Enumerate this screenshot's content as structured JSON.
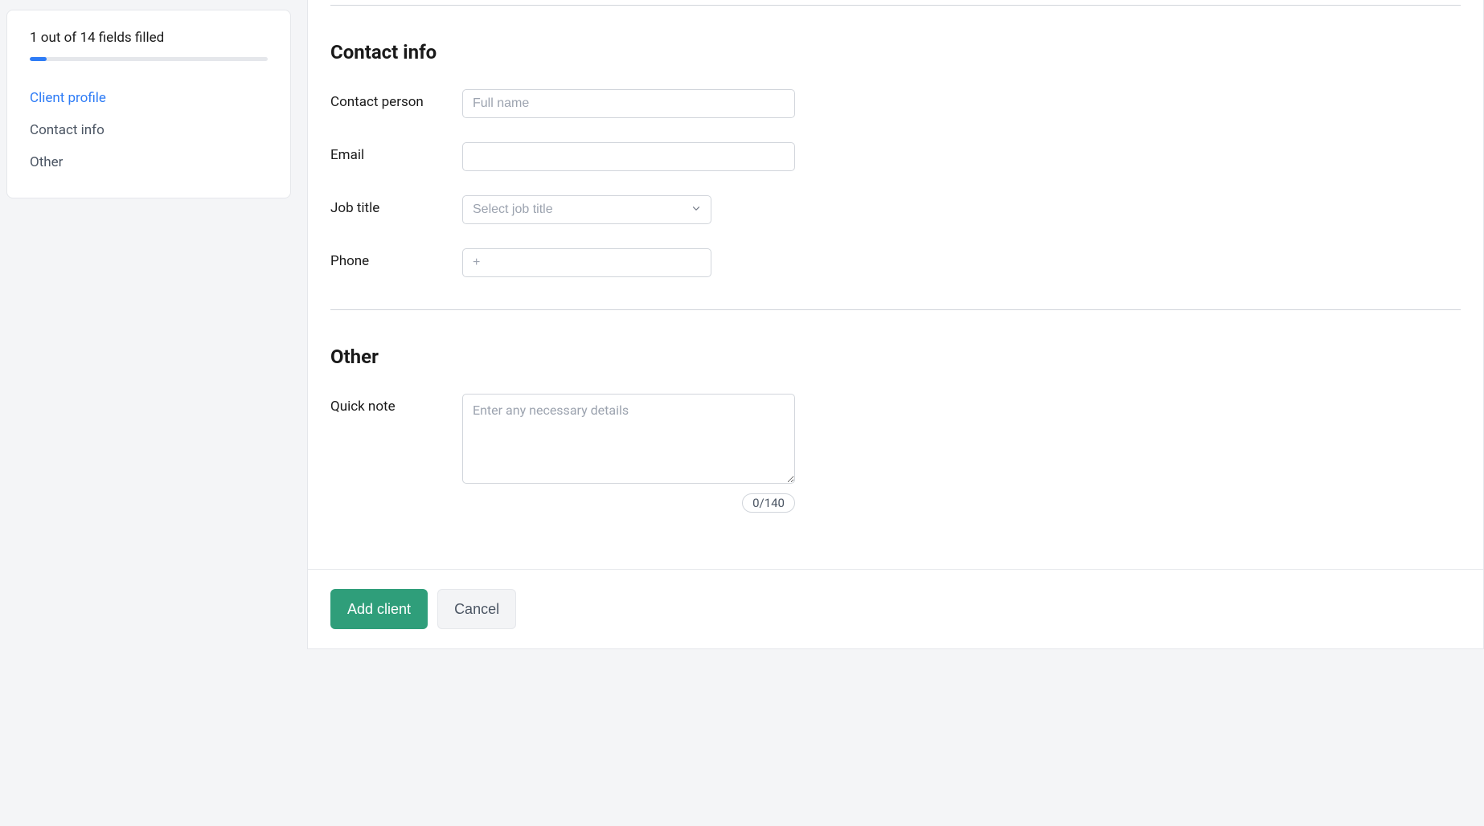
{
  "sidebar": {
    "progress_text": "1 out of 14 fields filled",
    "nav": [
      {
        "label": "Client profile",
        "active": true
      },
      {
        "label": "Contact info",
        "active": false
      },
      {
        "label": "Other",
        "active": false
      }
    ]
  },
  "sections": {
    "contact_info": {
      "title": "Contact info",
      "fields": {
        "contact_person": {
          "label": "Contact person",
          "placeholder": "Full name",
          "value": ""
        },
        "email": {
          "label": "Email",
          "placeholder": "",
          "value": ""
        },
        "job_title": {
          "label": "Job title",
          "placeholder": "Select job title",
          "value": ""
        },
        "phone": {
          "label": "Phone",
          "placeholder": "+",
          "value": ""
        }
      }
    },
    "other": {
      "title": "Other",
      "fields": {
        "quick_note": {
          "label": "Quick note",
          "placeholder": "Enter any necessary details",
          "value": "",
          "counter": "0/140"
        }
      }
    }
  },
  "footer": {
    "primary": "Add client",
    "secondary": "Cancel"
  }
}
